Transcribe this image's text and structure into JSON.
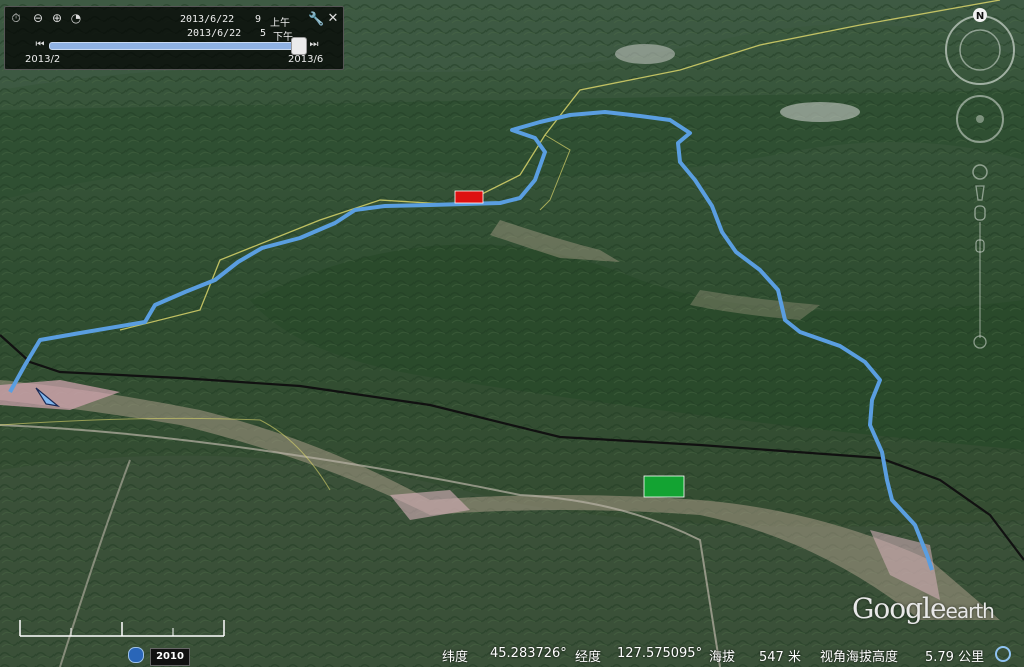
{
  "time_slider": {
    "start_date": "2013/6/22",
    "start_hour": "9",
    "start_period": "上午",
    "end_date": "2013/6/22",
    "end_hour": "5",
    "end_period": "下午",
    "range_start": "2013/2",
    "range_end": "2013/6",
    "position": 0.97
  },
  "compass": {
    "north_label": "N"
  },
  "status_bar": {
    "imagery_year": "2010",
    "lat_label": "纬度",
    "lat_value": "45.283726°",
    "lon_label": "经度",
    "lon_value": "127.575095°",
    "alt_label": "海拔",
    "alt_value": "547 米",
    "eye_label": "视角海拔高度",
    "eye_value": "5.79 公里"
  },
  "watermark": {
    "brand": "Google",
    "product": "earth"
  },
  "colors": {
    "route": "#5a9ee0",
    "boundary": "#d8d36a",
    "rail": "#111111",
    "start_marker": "#dd1111",
    "end_marker": "#13a332"
  }
}
